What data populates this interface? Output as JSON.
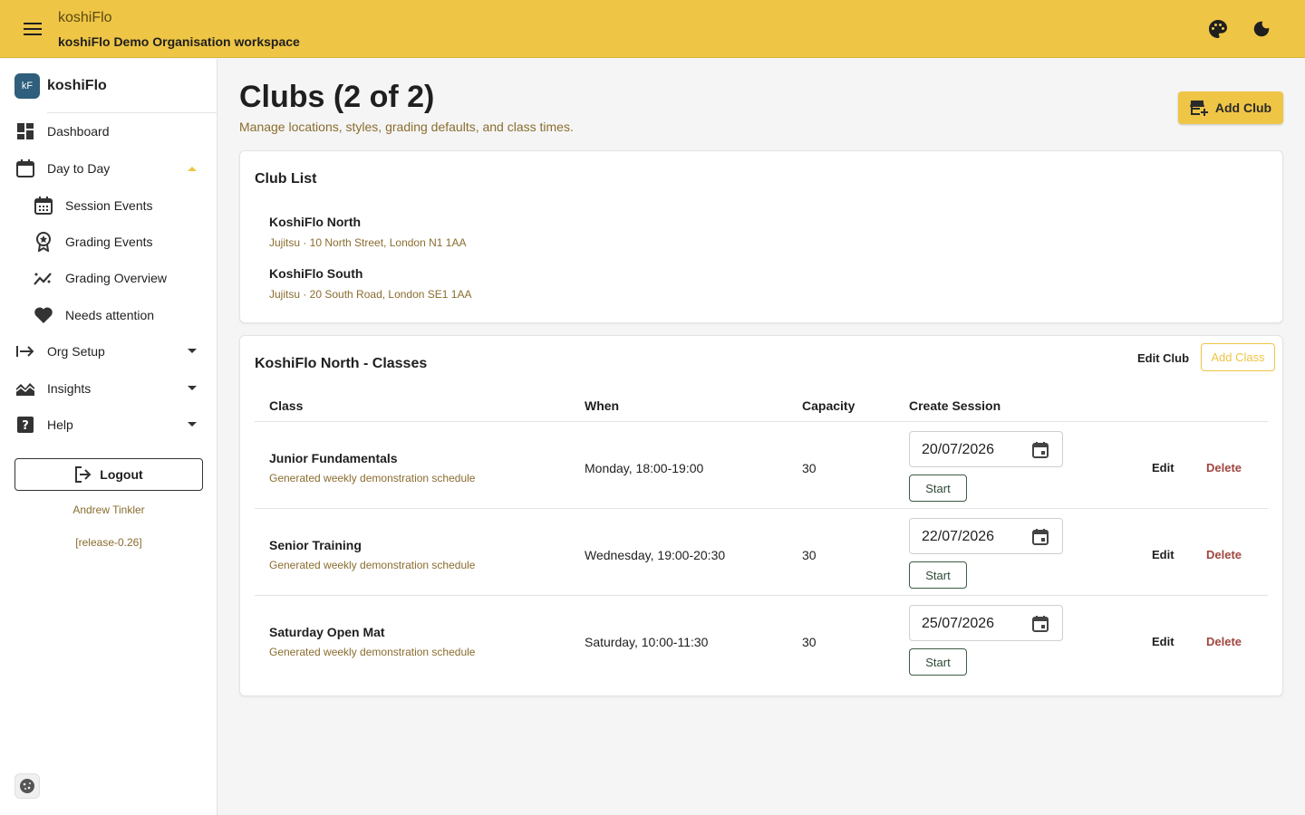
{
  "topbar": {
    "app_title": "koshiFlo",
    "workspace": "koshiFlo Demo Organisation workspace",
    "menu_icon": "hamburger-menu-icon",
    "palette_icon": "palette-icon",
    "theme_icon": "dark-mode-moon-icon"
  },
  "brand": {
    "logo_text": "kF",
    "name": "koshiFlo"
  },
  "nav": {
    "dashboard": "Dashboard",
    "day_to_day": "Day to Day",
    "session_events": "Session Events",
    "grading_events": "Grading Events",
    "grading_overview": "Grading Overview",
    "needs_attention": "Needs attention",
    "org_setup": "Org Setup",
    "insights": "Insights",
    "help": "Help"
  },
  "logout_label": "Logout",
  "user_name": "Andrew Tinkler",
  "release": "[release-0.26]",
  "page": {
    "title": "Clubs (2 of 2)",
    "subtitle": "Manage locations, styles, grading defaults, and class times.",
    "add_club_label": "Add Club"
  },
  "club_list": {
    "title": "Club List",
    "clubs": [
      {
        "name": "KoshiFlo North",
        "meta": "Jujitsu · 10 North Street, London N1 1AA"
      },
      {
        "name": "KoshiFlo South",
        "meta": "Jujitsu · 20 South Road, London SE1 1AA"
      }
    ]
  },
  "classes": {
    "title": "KoshiFlo North - Classes",
    "edit_club_label": "Edit Club",
    "add_class_label": "Add Class",
    "headers": {
      "class": "Class",
      "when": "When",
      "capacity": "Capacity",
      "create_session": "Create Session"
    },
    "rows": [
      {
        "name": "Junior Fundamentals",
        "desc": "Generated weekly demonstration schedule",
        "when": "Monday, 18:00-19:00",
        "capacity": "30",
        "date": "20/07/2026",
        "start": "Start",
        "edit": "Edit",
        "delete": "Delete"
      },
      {
        "name": "Senior Training",
        "desc": "Generated weekly demonstration schedule",
        "when": "Wednesday, 19:00-20:30",
        "capacity": "30",
        "date": "22/07/2026",
        "start": "Start",
        "edit": "Edit",
        "delete": "Delete"
      },
      {
        "name": "Saturday Open Mat",
        "desc": "Generated weekly demonstration schedule",
        "when": "Saturday, 10:00-11:30",
        "capacity": "30",
        "date": "25/07/2026",
        "start": "Start",
        "edit": "Edit",
        "delete": "Delete"
      }
    ]
  },
  "colors": {
    "accent": "#eec545",
    "text_muted": "#8a6d2f",
    "danger": "#a0463f",
    "start_border": "#3c5a43"
  }
}
